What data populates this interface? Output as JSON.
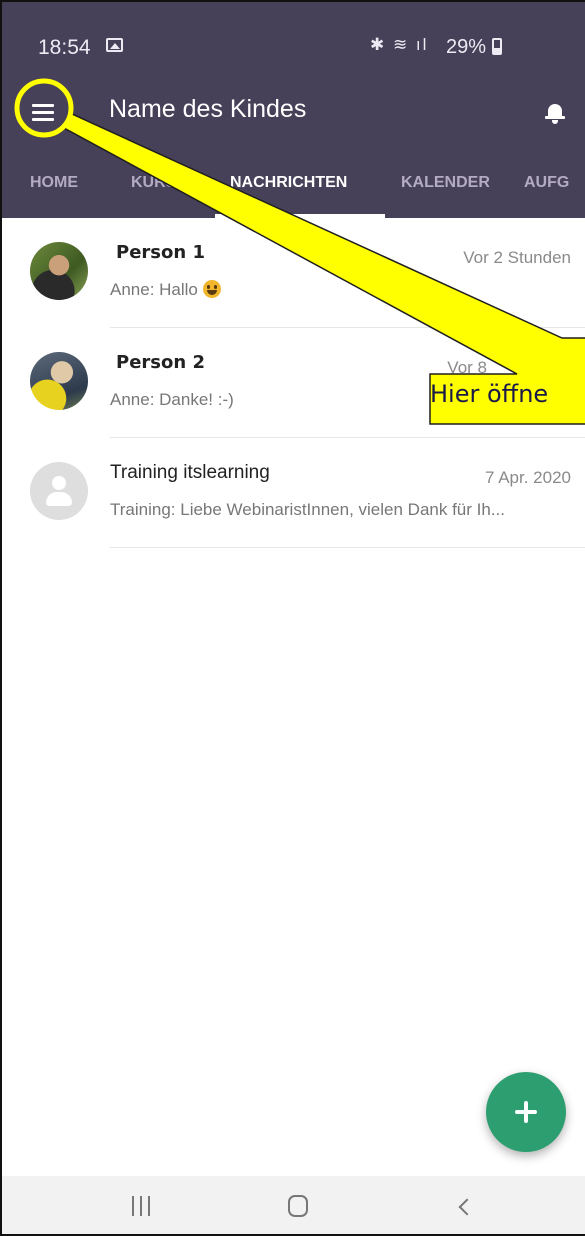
{
  "status_bar": {
    "time": "18:54",
    "battery": "29%"
  },
  "app_bar": {
    "title": "Name des Kindes"
  },
  "tabs": [
    {
      "label": "HOME",
      "active": false
    },
    {
      "label": "KURSE",
      "active": false
    },
    {
      "label": "NACHRICHTEN",
      "active": true
    },
    {
      "label": "KALENDER",
      "active": false
    },
    {
      "label": "AUFG",
      "active": false
    }
  ],
  "messages": [
    {
      "name": "Person 1",
      "time": "Vor 2 Stunden",
      "preview": "Anne: Hallo"
    },
    {
      "name": "Person 2",
      "time": "Vor 8",
      "preview": "Anne: Danke! :-)"
    },
    {
      "name": "Training itslearning",
      "time": "7 Apr. 2020",
      "preview": "Training: Liebe WebinaristInnen, vielen Dank für Ih..."
    }
  ],
  "annotation": {
    "text": "Hier öffne"
  },
  "colors": {
    "header": "#464058",
    "fab": "#2d9e6f",
    "callout": "#ffff00"
  }
}
